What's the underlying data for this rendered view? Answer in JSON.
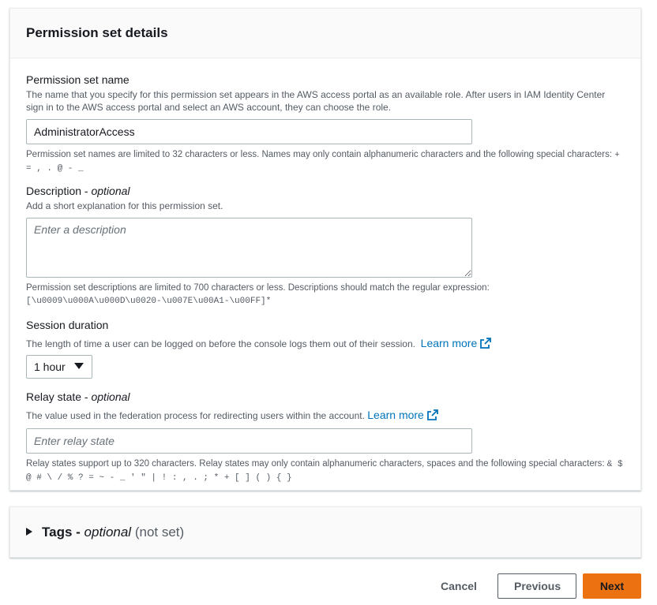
{
  "section": {
    "title": "Permission set details"
  },
  "name": {
    "label": "Permission set name",
    "description": "The name that you specify for this permission set appears in the AWS access portal as an available role. After users in IAM Identity Center sign in to the AWS access portal and select an AWS account, they can choose the role.",
    "value": "AdministratorAccess",
    "hint": "Permission set names are limited to 32 characters or less. Names may only contain alphanumeric characters and the following special characters:",
    "hint_chars": "+ = , . @ - _"
  },
  "description": {
    "label": "Description - ",
    "optional": "optional",
    "description": "Add a short explanation for this permission set.",
    "placeholder": "Enter a description",
    "hint": "Permission set descriptions are limited to 700 characters or less. Descriptions should match the regular expression:",
    "regex": "[\\u0009\\u000A\\u000D\\u0020-\\u007E\\u00A1-\\u00FF]*"
  },
  "session": {
    "label": "Session duration",
    "description": "The length of time a user can be logged on before the console logs them out of their session.",
    "learn_more": "Learn more",
    "value": "1 hour"
  },
  "relay": {
    "label": "Relay state - ",
    "optional": "optional",
    "description": "The value used in the federation process for redirecting users within the account.",
    "learn_more": "Learn more",
    "placeholder": "Enter relay state",
    "hint": "Relay states support up to 320 characters. Relay states may only contain alphanumeric characters, spaces and the following special characters:",
    "hint_chars": "& $ @ # \\ / % ? = ~ - _ ' \" | ! : , . ; * + [ ] ( ) { }"
  },
  "tags": {
    "title": "Tags - ",
    "optional": "optional",
    "status": "(not set)"
  },
  "footer": {
    "cancel": "Cancel",
    "previous": "Previous",
    "next": "Next"
  },
  "colors": {
    "primary": "#ec7211",
    "link": "#0073bb"
  }
}
